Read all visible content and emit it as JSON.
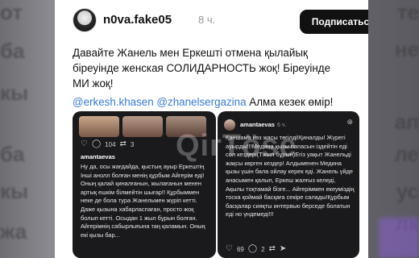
{
  "post": {
    "username": "n0va.fake05",
    "time": "8 ч.",
    "subscribe_label": "Подписаться",
    "line1": "Давайте Жанель мен Еркешті отмена қылайық",
    "line2": "біреуінде женская СОЛИДАРНОСТЬ жоқ! Біреуінде",
    "line3": "МИ жоқ!",
    "mention1": "@erkesh.khasen",
    "mention2": "@zhanelsergazina",
    "line4_tail": " Алма кезек өмір!"
  },
  "left_shot": {
    "likes": "104",
    "comments": "3",
    "username": "amantaevas",
    "body": "Ну да, осы жағдайда, қыстың ауыр Еркештің Інші анолл болған менің құрбым Айгерім еді! Оның қалай қиналғанын, жылағанын менен артық ешкім білмейтін шығар!! Құрбыммен неке де бола тура Жанельмен жүріп кетті. Даже қызына хабарласпаған, просто жоқ болып кетті. Осыдан 1 жыл бұрын болған. Айгерімнің сабырлығына таң қаламын. Оның екі қызы бар..."
  },
  "right_shot": {
    "username": "amantaevas",
    "time": "6 ч.",
    "body": "Қаншама көз жасы төгілді!Қиналды! Жүрегі ауырды!!!Медина қызы папасын іздейтін еді сол кездері(Тжыл бұрын)Егіз уақыт Жанельді жақсы көрген кездер! Алдыменен Медина қызы үшін бала ойлау керек еді. Жанель үйде анасымен қалып, Еркеш жалғыз келеді, Ақылы тоқтамай бізге... Айгеріммен екеуміздің тоска қоймай басқаға секіре салады!Құрбым басқалар сияқты интервью берседе болатын еді но үндемеді!!!",
    "likes": "69",
    "comments": "2"
  },
  "watermark": "QirTöse",
  "background": {
    "left_fragments": [
      "от",
      "ба",
      "кы",
      "ба",
      "кы",
      "жа"
    ],
    "right_fragments": [
      "те",
      "не",
      "ап",
      "ле",
      "ус",
      "лк"
    ]
  },
  "colors": {
    "accent_mention": "#3a7bd5",
    "button_bg": "#111111",
    "card_bg": "#ffffff",
    "thumb_bg": "#1a1a1c"
  }
}
